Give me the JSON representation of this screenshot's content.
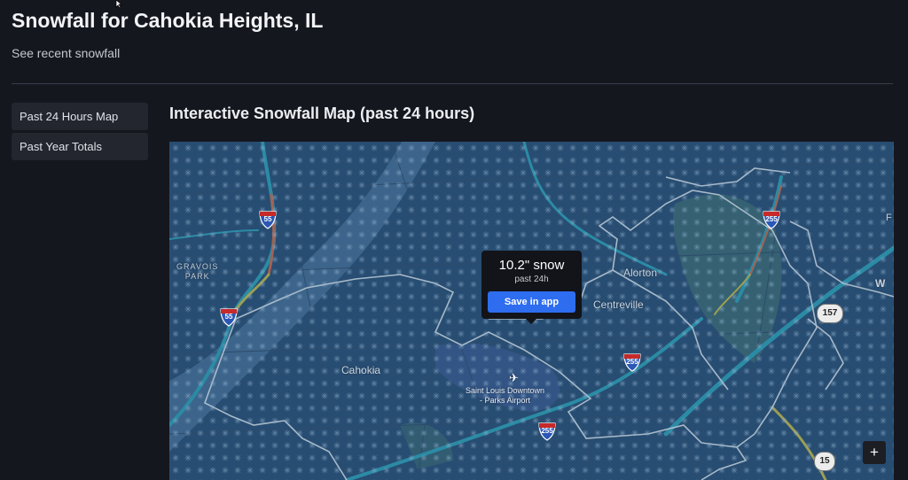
{
  "page": {
    "title": "Snowfall for Cahokia Heights, IL",
    "subtitle": "See recent snowfall"
  },
  "sidebar": {
    "items": [
      {
        "label": "Past 24 Hours Map"
      },
      {
        "label": "Past Year Totals"
      }
    ]
  },
  "main": {
    "section_title": "Interactive Snowfall Map (past 24 hours)"
  },
  "map": {
    "labels": {
      "gravois_park": "GRAVOIS\nPARK",
      "cahokia": "Cahokia",
      "alorton": "Alorton",
      "centreville": "Centreville",
      "airport": "Saint Louis Downtown\n- Parks Airport",
      "edge_letter": "W",
      "edge_letter_top": "F"
    },
    "shields": {
      "i55_top": "55",
      "i55_left": "55",
      "i255_top_right": "255",
      "i255_center": "255",
      "i255_bottom": "255"
    },
    "ovals": {
      "route_157": "157",
      "route_15": "15"
    },
    "popup": {
      "amount": "10.2\" snow",
      "period": "past 24h",
      "button": "Save in app"
    },
    "zoom_in": "+",
    "colors": {
      "snow_overlay": "#2f5a80",
      "boundary": "#ffffff",
      "highway": "#2aa6b8",
      "traffic_heavy": "#e0663a",
      "traffic_moderate": "#d8c43a",
      "accent_button": "#2e6df0"
    }
  }
}
